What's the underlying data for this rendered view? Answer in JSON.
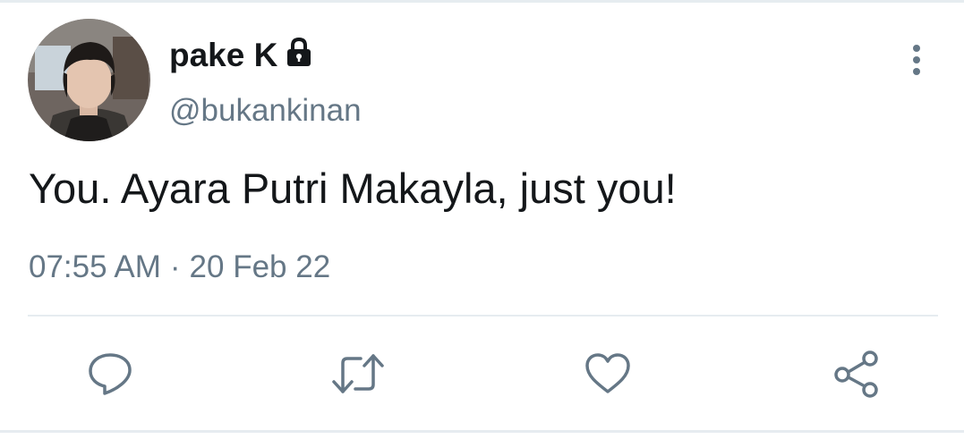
{
  "tweet": {
    "author": {
      "display_name": "pake K",
      "handle": "@bukankinan",
      "avatar_icon": "profile-photo",
      "protected_icon": "lock-icon"
    },
    "text": "You. Ayara Putri Makayla, just you!",
    "time": "07:55 AM",
    "separator": "·",
    "date": "20 Feb 22"
  },
  "actions": [
    {
      "name": "reply",
      "icon": "comment-icon"
    },
    {
      "name": "retweet",
      "icon": "retweet-icon"
    },
    {
      "name": "like",
      "icon": "heart-icon"
    },
    {
      "name": "share",
      "icon": "share-icon"
    }
  ],
  "colors": {
    "text_primary": "#14171a",
    "text_secondary": "#657786",
    "icon": "#657786",
    "divider": "#e6ecf0"
  }
}
